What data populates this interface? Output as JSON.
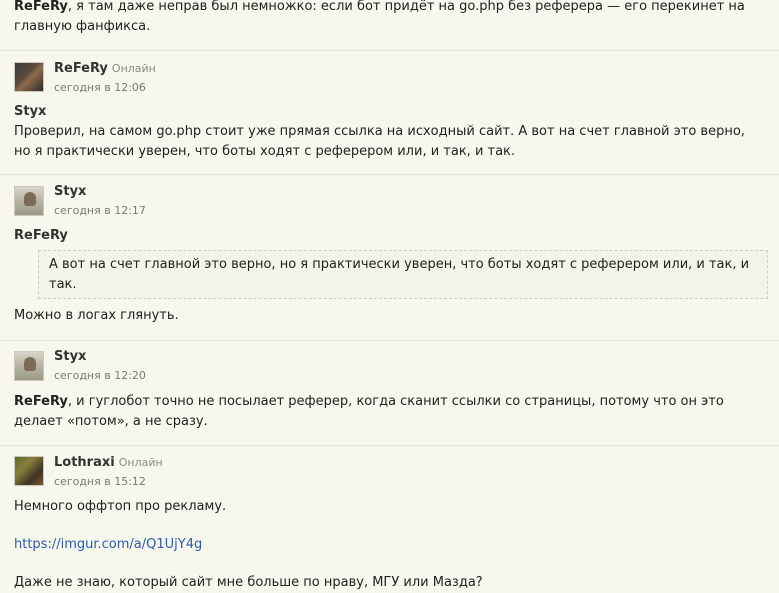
{
  "post0": {
    "nick": "ReFeRy",
    "text": ", я там даже неправ был немножко: если бот придёт на go.php без реферера — его перекинет на главную фанфикса."
  },
  "post1": {
    "author": "ReFeRy",
    "status": "Онлайн",
    "time": "сегодня в 12:06",
    "quote_author": "Styx",
    "text": "Проверил, на самом go.php стоит уже прямая ссылка на исходный сайт. А вот на счет главной это верно, но я практически уверен, что боты ходят с реферером или, и так, и так."
  },
  "post2": {
    "author": "Styx",
    "time": "сегодня в 12:17",
    "quote_author": "ReFeRy",
    "quote_text": "А вот на счет главной это верно, но я практически уверен, что боты ходят с реферером или, и так, и так.",
    "text": "Можно в логах глянуть."
  },
  "post3": {
    "author": "Styx",
    "time": "сегодня в 12:20",
    "nick": "ReFeRy",
    "text": ", и гуглобот точно не посылает реферер, когда сканит ссылки со страницы, потому что он это делает «потом», а не сразу."
  },
  "post4": {
    "author": "Lothraxi",
    "status": "Онлайн",
    "time": "сегодня в 15:12",
    "text1": "Немного оффтоп про рекламу.",
    "link": "https://imgur.com/a/Q1UjY4g",
    "text2": "Даже не знаю, который сайт мне больше по нраву, МГУ или Мазда?"
  }
}
